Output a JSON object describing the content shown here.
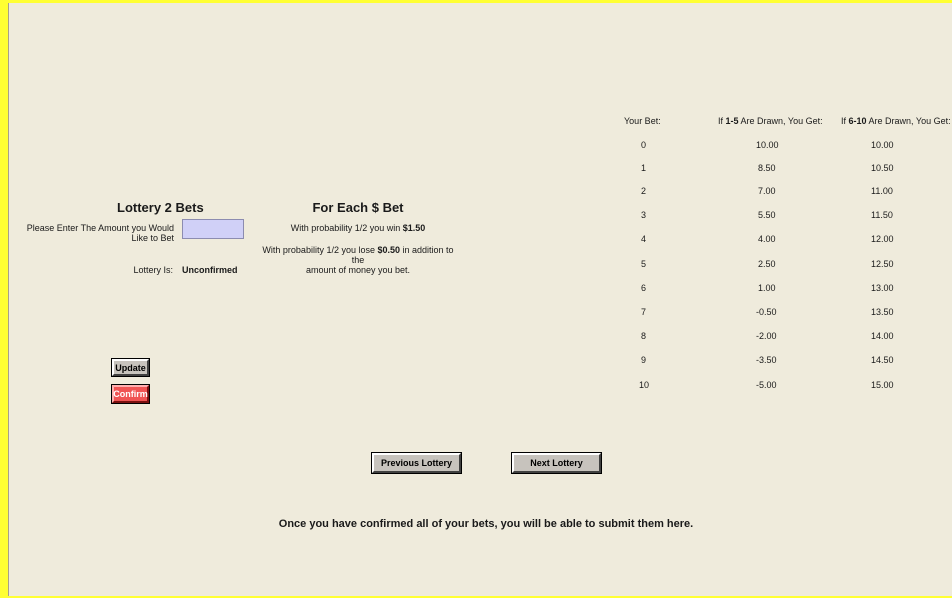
{
  "lottery": {
    "title": "Lottery 2 Bets",
    "amount_prompt_line1": "Please Enter The Amount you Would",
    "amount_prompt_line2": "Like to Bet",
    "amount_value": "",
    "status_label": "Lottery Is:",
    "status_value": "Unconfirmed"
  },
  "odds": {
    "title": "For Each $ Bet",
    "win_prefix": "With probability 1/2 you win ",
    "win_amount": "$1.50",
    "lose_prefix": "With probability 1/2 you lose ",
    "lose_amount": "$0.50",
    "lose_suffix": "  in addition to the",
    "lose_line2": "amount of money you bet."
  },
  "buttons": {
    "update": "Update",
    "confirm": "Confirm",
    "previous": "Previous Lottery",
    "next": "Next Lottery"
  },
  "footer": {
    "message": "Once you have confirmed all of your bets, you will be able to submit them here."
  },
  "payoff_table": {
    "headers": {
      "bet": "Your Bet:",
      "low_prefix": "If ",
      "low_range": "1-5",
      "low_suffix": " Are Drawn, You Get:",
      "high_prefix": "If ",
      "high_range": "6-10",
      "high_suffix": " Are Drawn, You Get:"
    },
    "rows": [
      {
        "bet": "0",
        "low": "10.00",
        "high": "10.00"
      },
      {
        "bet": "1",
        "low": "8.50",
        "high": "10.50"
      },
      {
        "bet": "2",
        "low": "7.00",
        "high": "11.00"
      },
      {
        "bet": "3",
        "low": "5.50",
        "high": "11.50"
      },
      {
        "bet": "4",
        "low": "4.00",
        "high": "12.00"
      },
      {
        "bet": "5",
        "low": "2.50",
        "high": "12.50"
      },
      {
        "bet": "6",
        "low": "1.00",
        "high": "13.00"
      },
      {
        "bet": "7",
        "low": "-0.50",
        "high": "13.50"
      },
      {
        "bet": "8",
        "low": "-2.00",
        "high": "14.00"
      },
      {
        "bet": "9",
        "low": "-3.50",
        "high": "14.50"
      },
      {
        "bet": "10",
        "low": "-5.00",
        "high": "15.00"
      }
    ]
  },
  "colors": {
    "background": "#efebdc",
    "frame": "#ffff33",
    "input": "#d0d0f7",
    "confirm": "#f05454",
    "button": "#c7c3bd"
  }
}
